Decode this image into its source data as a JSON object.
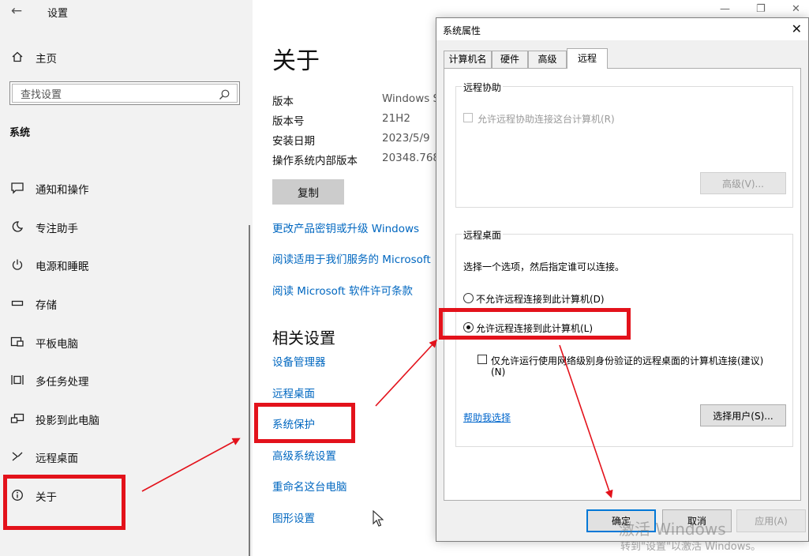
{
  "settings": {
    "title": "设置",
    "home_label": "主页",
    "search_placeholder": "查找设置",
    "section_label": "系统",
    "nav_items": [
      {
        "label": "通知和操作",
        "icon": "notification-icon"
      },
      {
        "label": "专注助手",
        "icon": "moon-icon"
      },
      {
        "label": "电源和睡眠",
        "icon": "power-icon"
      },
      {
        "label": "存储",
        "icon": "storage-icon"
      },
      {
        "label": "平板电脑",
        "icon": "tablet-icon"
      },
      {
        "label": "多任务处理",
        "icon": "multitasking-icon"
      },
      {
        "label": "投影到此电脑",
        "icon": "project-icon"
      },
      {
        "label": "远程桌面",
        "icon": "remote-desktop-icon"
      },
      {
        "label": "关于",
        "icon": "info-icon"
      }
    ]
  },
  "about": {
    "title": "关于",
    "specs": [
      {
        "label": "版本",
        "value": "Windows S"
      },
      {
        "label": "版本号",
        "value": "21H2"
      },
      {
        "label": "安装日期",
        "value": "2023/5/9"
      },
      {
        "label": "操作系统内部版本",
        "value": "20348.768"
      }
    ],
    "copy_label": "复制",
    "links": [
      "更改产品密钥或升级 Windows",
      "阅读适用于我们服务的 Microsoft",
      "阅读 Microsoft 软件许可条款"
    ],
    "related_title": "相关设置",
    "related_links": [
      "设备管理器",
      "远程桌面",
      "系统保护",
      "高级系统设置",
      "重命名这台电脑",
      "图形设置"
    ]
  },
  "dialog": {
    "title": "系统属性",
    "tabs": [
      "计算机名",
      "硬件",
      "高级",
      "远程"
    ],
    "active_tab": "远程",
    "remote_assist": {
      "group_title": "远程协助",
      "checkbox_label": "允许远程协助连接这台计算机(R)",
      "advanced_label": "高级(V)..."
    },
    "remote_desktop": {
      "group_title": "远程桌面",
      "intro": "选择一个选项，然后指定谁可以连接。",
      "option_deny": "不允许远程连接到此计算机(D)",
      "option_allow": "允许远程连接到此计算机(L)",
      "nla_label_line1": "仅允许运行使用网络级别身份验证的远程桌面的计算机连接(建议)",
      "nla_label_line2": "(N)",
      "help_link": "帮助我选择",
      "select_users_label": "选择用户(S)..."
    },
    "buttons": {
      "ok": "确定",
      "cancel": "取消",
      "apply": "应用(A)"
    }
  },
  "watermark": {
    "line1": "激活 Windows",
    "line2": "转到\"设置\"以激活 Windows。"
  },
  "colors": {
    "highlight": "#e3121b",
    "link": "#0067c0",
    "sidebar_bg": "#f2f2f2"
  }
}
